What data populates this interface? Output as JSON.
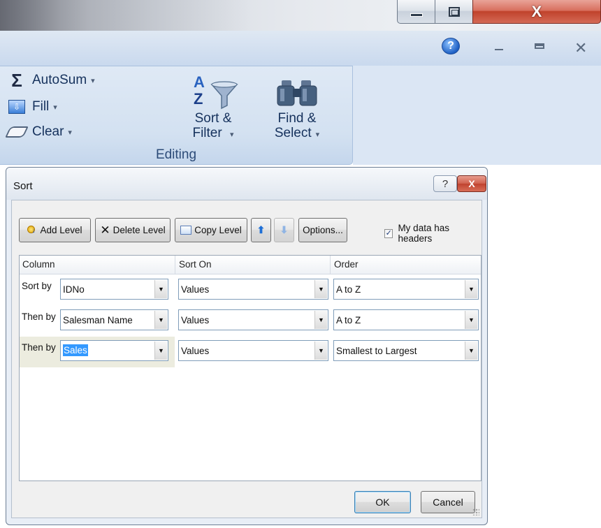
{
  "window_controls": {
    "minimize": "—",
    "maximize": "□",
    "close": "X"
  },
  "ribbon": {
    "help": "?",
    "doc_close": "✕",
    "editing_group": {
      "label": "Editing",
      "autosum_label": "AutoSum",
      "fill_label": "Fill",
      "clear_label": "Clear",
      "sort_filter_line1": "Sort &",
      "sort_filter_line2": "Filter",
      "find_select_line1": "Find &",
      "find_select_line2": "Select",
      "dropdown_arrow": "▾"
    }
  },
  "dialog": {
    "title": "Sort",
    "help_button": "?",
    "close_button": "X",
    "toolbar": {
      "add_level": "Add Level",
      "delete_level": "Delete Level",
      "copy_level": "Copy Level",
      "move_up": "⬆",
      "move_down": "⬇",
      "options": "Options..."
    },
    "headers_checkbox": {
      "label": "My data has headers",
      "checked": true,
      "check_glyph": "✓"
    },
    "grid": {
      "headers": [
        "Column",
        "Sort On",
        "Order"
      ],
      "rows": [
        {
          "label": "Sort by",
          "column": "IDNo",
          "sort_on": "Values",
          "order": "A to Z"
        },
        {
          "label": "Then by",
          "column": "Salesman Name",
          "sort_on": "Values",
          "order": "A to Z"
        },
        {
          "label": "Then by",
          "column": "Sales",
          "sort_on": "Values",
          "order": "Smallest to Largest"
        }
      ],
      "combo_arrow": "▼"
    },
    "ok_label": "OK",
    "cancel_label": "Cancel"
  }
}
